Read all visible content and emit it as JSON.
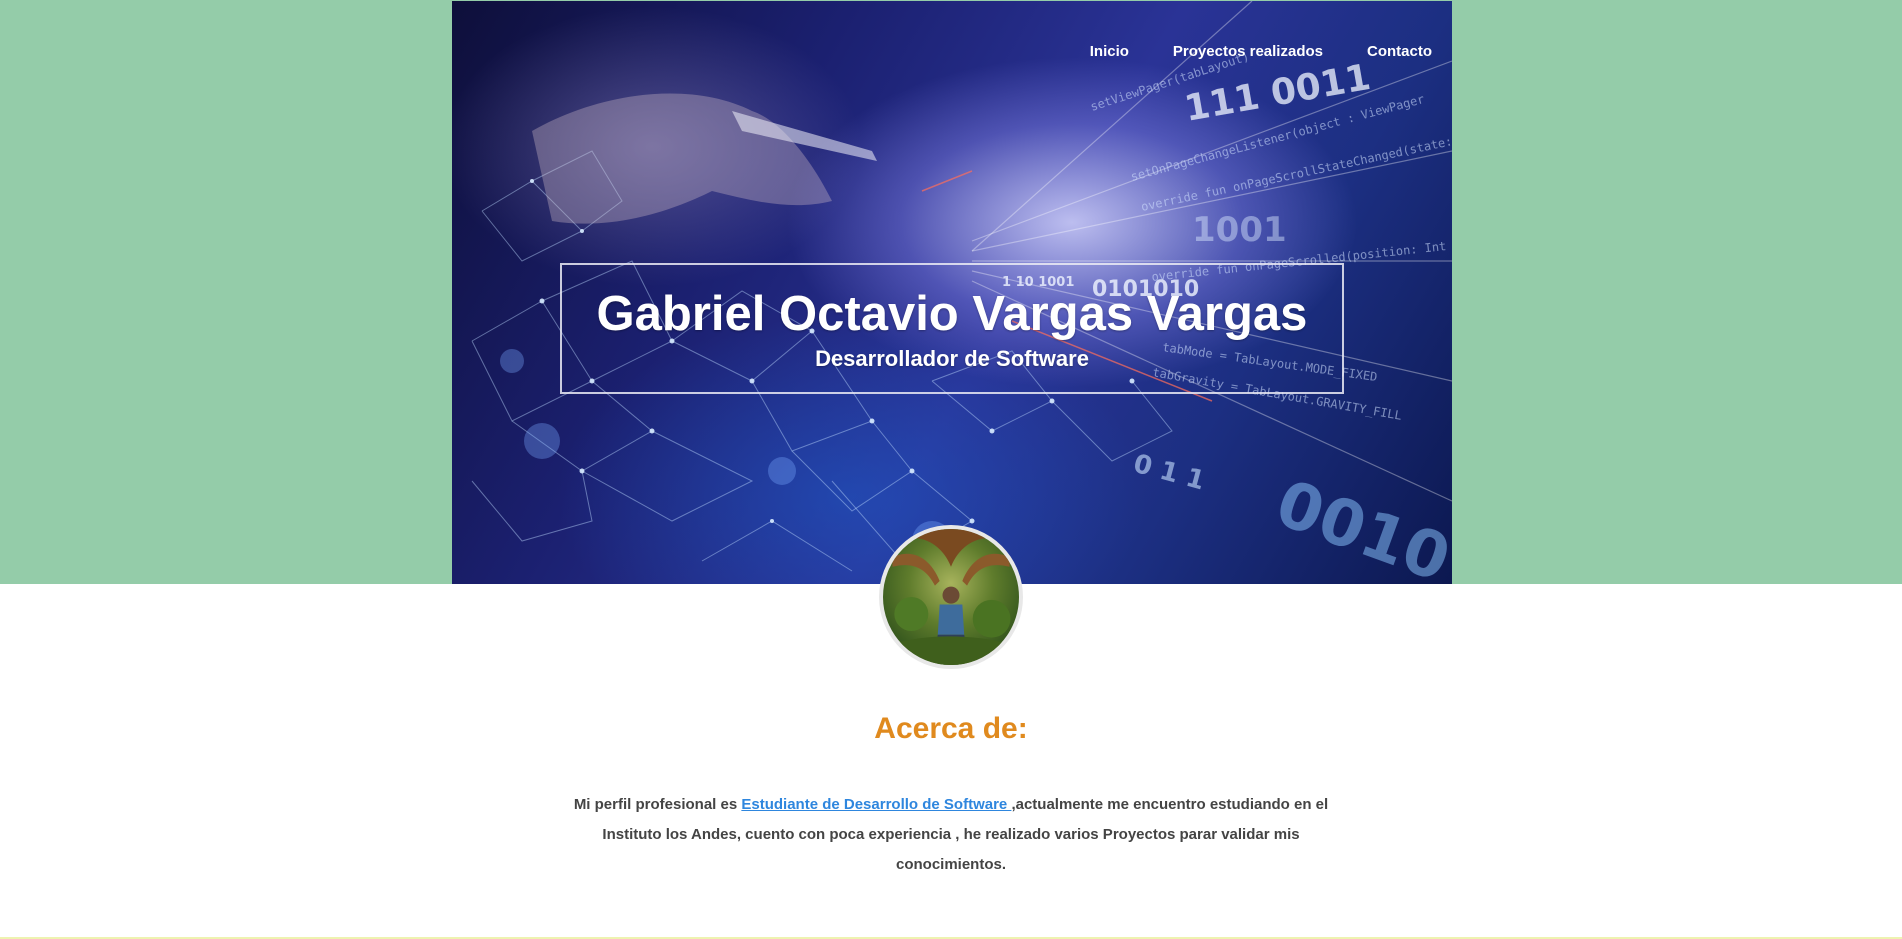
{
  "nav": {
    "items": [
      {
        "label": "Inicio"
      },
      {
        "label": "Proyectos realizados"
      },
      {
        "label": "Contacto"
      }
    ]
  },
  "hero": {
    "name": "Gabriel Octavio Vargas Vargas",
    "subtitle": "Desarrollador de Software",
    "background_texts": [
      "1001",
      "0010",
      "111 0011",
      "0 1 1",
      "1 10 1001",
      "0101010"
    ]
  },
  "about": {
    "title": "Acerca de:",
    "text_before": "Mi perfil profesional es ",
    "link_text": "Estudiante de Desarrollo de Software ",
    "text_after": ",actualmente me encuentro estudiando en el Instituto los Andes, cuento con poca experiencia , he realizado varios Proyectos parar validar mis conocimientos."
  },
  "colors": {
    "band_green": "#94cca9",
    "title_orange": "#e08a1e",
    "link_blue": "#2e86de",
    "text_gray": "#444444"
  }
}
